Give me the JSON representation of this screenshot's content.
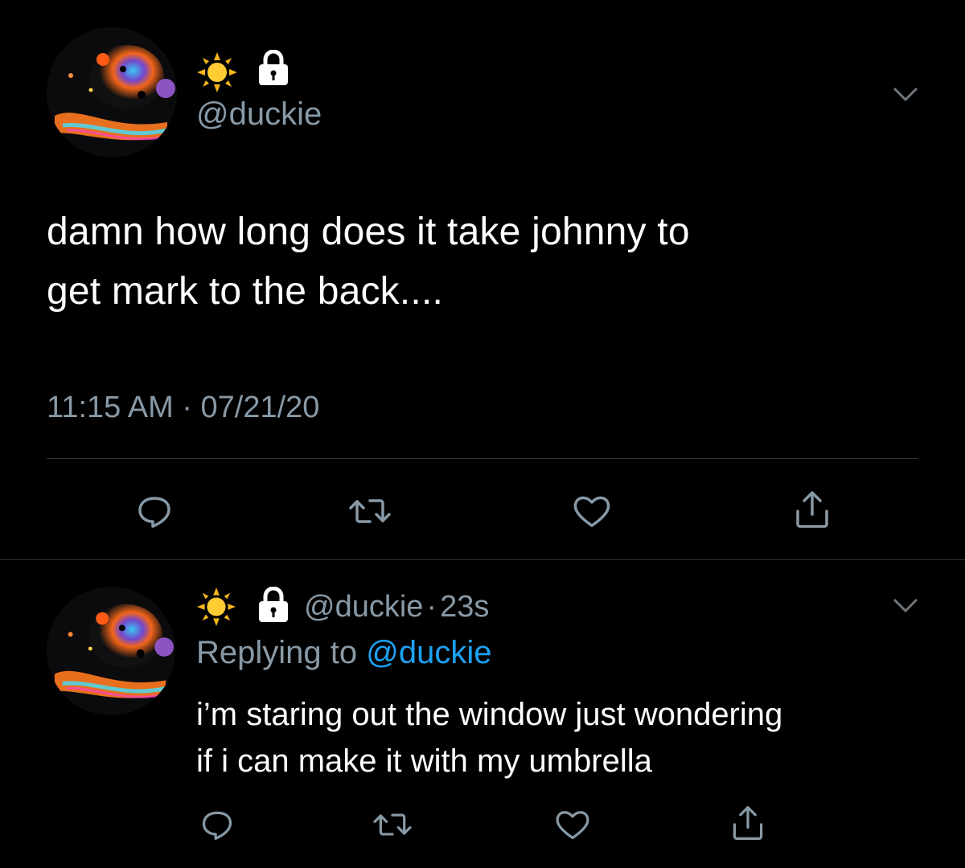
{
  "colors": {
    "background": "#000000",
    "text": "#ffffff",
    "muted": "#8899a6",
    "link": "#1da1f2",
    "divider": "#2f3336"
  },
  "main_tweet": {
    "handle": "@duckie",
    "text_line1": "damn how long does it take johnny to",
    "text_line2": "get mark to the back....",
    "timestamp": "11:15 AM · 07/21/20",
    "name_icons": [
      "sun-icon",
      "lock-icon"
    ],
    "actions": [
      "reply-icon",
      "retweet-icon",
      "like-icon",
      "share-icon"
    ]
  },
  "reply_tweet": {
    "handle": "@duckie",
    "separator": "·",
    "time": "23s",
    "replying_prefix": "Replying to",
    "replying_mention": "@duckie",
    "text_line1": "i’m staring out the window just wondering",
    "text_line2": "if i can make it with my umbrella",
    "name_icons": [
      "sun-icon",
      "lock-icon"
    ],
    "actions": [
      "reply-icon",
      "retweet-icon",
      "like-icon",
      "share-icon"
    ]
  }
}
